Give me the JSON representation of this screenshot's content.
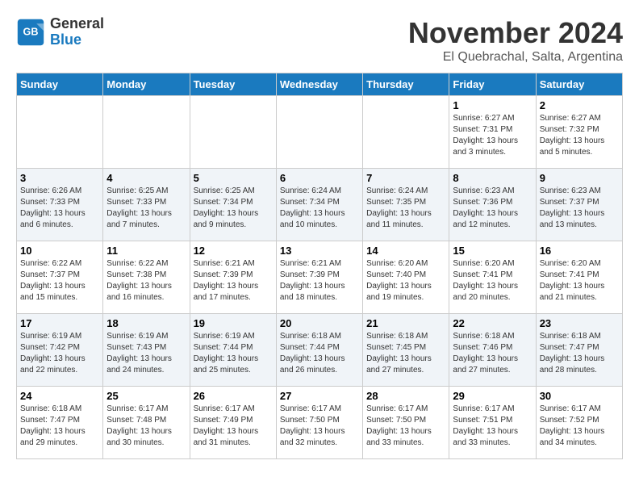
{
  "logo": {
    "text_general": "General",
    "text_blue": "Blue"
  },
  "title": "November 2024",
  "location": "El Quebrachal, Salta, Argentina",
  "days_of_week": [
    "Sunday",
    "Monday",
    "Tuesday",
    "Wednesday",
    "Thursday",
    "Friday",
    "Saturday"
  ],
  "weeks": [
    [
      {
        "day": "",
        "sunrise": "",
        "sunset": "",
        "daylight": ""
      },
      {
        "day": "",
        "sunrise": "",
        "sunset": "",
        "daylight": ""
      },
      {
        "day": "",
        "sunrise": "",
        "sunset": "",
        "daylight": ""
      },
      {
        "day": "",
        "sunrise": "",
        "sunset": "",
        "daylight": ""
      },
      {
        "day": "",
        "sunrise": "",
        "sunset": "",
        "daylight": ""
      },
      {
        "day": "1",
        "sunrise": "Sunrise: 6:27 AM",
        "sunset": "Sunset: 7:31 PM",
        "daylight": "Daylight: 13 hours and 3 minutes."
      },
      {
        "day": "2",
        "sunrise": "Sunrise: 6:27 AM",
        "sunset": "Sunset: 7:32 PM",
        "daylight": "Daylight: 13 hours and 5 minutes."
      }
    ],
    [
      {
        "day": "3",
        "sunrise": "Sunrise: 6:26 AM",
        "sunset": "Sunset: 7:33 PM",
        "daylight": "Daylight: 13 hours and 6 minutes."
      },
      {
        "day": "4",
        "sunrise": "Sunrise: 6:25 AM",
        "sunset": "Sunset: 7:33 PM",
        "daylight": "Daylight: 13 hours and 7 minutes."
      },
      {
        "day": "5",
        "sunrise": "Sunrise: 6:25 AM",
        "sunset": "Sunset: 7:34 PM",
        "daylight": "Daylight: 13 hours and 9 minutes."
      },
      {
        "day": "6",
        "sunrise": "Sunrise: 6:24 AM",
        "sunset": "Sunset: 7:34 PM",
        "daylight": "Daylight: 13 hours and 10 minutes."
      },
      {
        "day": "7",
        "sunrise": "Sunrise: 6:24 AM",
        "sunset": "Sunset: 7:35 PM",
        "daylight": "Daylight: 13 hours and 11 minutes."
      },
      {
        "day": "8",
        "sunrise": "Sunrise: 6:23 AM",
        "sunset": "Sunset: 7:36 PM",
        "daylight": "Daylight: 13 hours and 12 minutes."
      },
      {
        "day": "9",
        "sunrise": "Sunrise: 6:23 AM",
        "sunset": "Sunset: 7:37 PM",
        "daylight": "Daylight: 13 hours and 13 minutes."
      }
    ],
    [
      {
        "day": "10",
        "sunrise": "Sunrise: 6:22 AM",
        "sunset": "Sunset: 7:37 PM",
        "daylight": "Daylight: 13 hours and 15 minutes."
      },
      {
        "day": "11",
        "sunrise": "Sunrise: 6:22 AM",
        "sunset": "Sunset: 7:38 PM",
        "daylight": "Daylight: 13 hours and 16 minutes."
      },
      {
        "day": "12",
        "sunrise": "Sunrise: 6:21 AM",
        "sunset": "Sunset: 7:39 PM",
        "daylight": "Daylight: 13 hours and 17 minutes."
      },
      {
        "day": "13",
        "sunrise": "Sunrise: 6:21 AM",
        "sunset": "Sunset: 7:39 PM",
        "daylight": "Daylight: 13 hours and 18 minutes."
      },
      {
        "day": "14",
        "sunrise": "Sunrise: 6:20 AM",
        "sunset": "Sunset: 7:40 PM",
        "daylight": "Daylight: 13 hours and 19 minutes."
      },
      {
        "day": "15",
        "sunrise": "Sunrise: 6:20 AM",
        "sunset": "Sunset: 7:41 PM",
        "daylight": "Daylight: 13 hours and 20 minutes."
      },
      {
        "day": "16",
        "sunrise": "Sunrise: 6:20 AM",
        "sunset": "Sunset: 7:41 PM",
        "daylight": "Daylight: 13 hours and 21 minutes."
      }
    ],
    [
      {
        "day": "17",
        "sunrise": "Sunrise: 6:19 AM",
        "sunset": "Sunset: 7:42 PM",
        "daylight": "Daylight: 13 hours and 22 minutes."
      },
      {
        "day": "18",
        "sunrise": "Sunrise: 6:19 AM",
        "sunset": "Sunset: 7:43 PM",
        "daylight": "Daylight: 13 hours and 24 minutes."
      },
      {
        "day": "19",
        "sunrise": "Sunrise: 6:19 AM",
        "sunset": "Sunset: 7:44 PM",
        "daylight": "Daylight: 13 hours and 25 minutes."
      },
      {
        "day": "20",
        "sunrise": "Sunrise: 6:18 AM",
        "sunset": "Sunset: 7:44 PM",
        "daylight": "Daylight: 13 hours and 26 minutes."
      },
      {
        "day": "21",
        "sunrise": "Sunrise: 6:18 AM",
        "sunset": "Sunset: 7:45 PM",
        "daylight": "Daylight: 13 hours and 27 minutes."
      },
      {
        "day": "22",
        "sunrise": "Sunrise: 6:18 AM",
        "sunset": "Sunset: 7:46 PM",
        "daylight": "Daylight: 13 hours and 27 minutes."
      },
      {
        "day": "23",
        "sunrise": "Sunrise: 6:18 AM",
        "sunset": "Sunset: 7:47 PM",
        "daylight": "Daylight: 13 hours and 28 minutes."
      }
    ],
    [
      {
        "day": "24",
        "sunrise": "Sunrise: 6:18 AM",
        "sunset": "Sunset: 7:47 PM",
        "daylight": "Daylight: 13 hours and 29 minutes."
      },
      {
        "day": "25",
        "sunrise": "Sunrise: 6:17 AM",
        "sunset": "Sunset: 7:48 PM",
        "daylight": "Daylight: 13 hours and 30 minutes."
      },
      {
        "day": "26",
        "sunrise": "Sunrise: 6:17 AM",
        "sunset": "Sunset: 7:49 PM",
        "daylight": "Daylight: 13 hours and 31 minutes."
      },
      {
        "day": "27",
        "sunrise": "Sunrise: 6:17 AM",
        "sunset": "Sunset: 7:50 PM",
        "daylight": "Daylight: 13 hours and 32 minutes."
      },
      {
        "day": "28",
        "sunrise": "Sunrise: 6:17 AM",
        "sunset": "Sunset: 7:50 PM",
        "daylight": "Daylight: 13 hours and 33 minutes."
      },
      {
        "day": "29",
        "sunrise": "Sunrise: 6:17 AM",
        "sunset": "Sunset: 7:51 PM",
        "daylight": "Daylight: 13 hours and 33 minutes."
      },
      {
        "day": "30",
        "sunrise": "Sunrise: 6:17 AM",
        "sunset": "Sunset: 7:52 PM",
        "daylight": "Daylight: 13 hours and 34 minutes."
      }
    ]
  ]
}
